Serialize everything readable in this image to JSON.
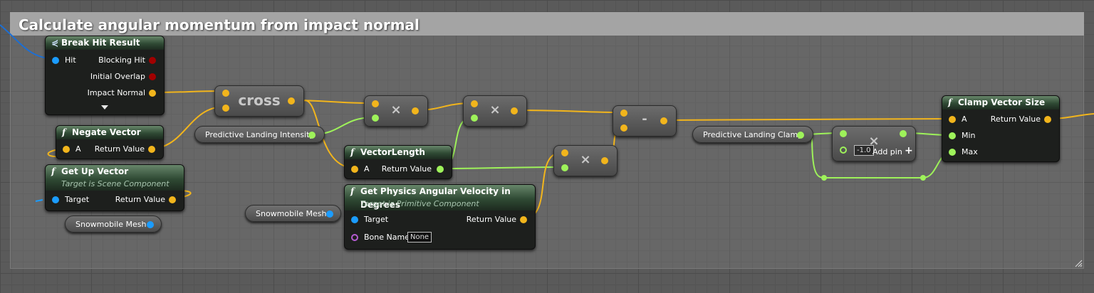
{
  "comment": {
    "title": "Calculate angular momentum from impact normal"
  },
  "nodes": {
    "break_hit": {
      "title": "Break Hit Result",
      "pins": {
        "hit": "Hit",
        "blocking_hit": "Blocking Hit",
        "initial_overlap": "Initial Overlap",
        "impact_normal": "Impact Normal"
      }
    },
    "negate": {
      "title": "Negate Vector",
      "a": "A",
      "ret": "Return Value"
    },
    "get_up": {
      "title": "Get Up Vector",
      "subtitle": "Target is Scene Component",
      "target": "Target",
      "ret": "Return Value"
    },
    "snowmobile_1": {
      "label": "Snowmobile Mesh"
    },
    "cross": {
      "label": "cross"
    },
    "intensity": {
      "label": "Predictive Landing Intensity"
    },
    "mul1": {
      "label": "×"
    },
    "mul2": {
      "label": "×"
    },
    "mul3": {
      "label": "×"
    },
    "vlen": {
      "title": "VectorLength",
      "a": "A",
      "ret": "Return Value"
    },
    "snowmobile_2": {
      "label": "Snowmobile Mesh"
    },
    "angvel": {
      "title": "Get Physics Angular Velocity in Degrees",
      "subtitle": "Target is Primitive Component",
      "target": "Target",
      "bone": "Bone Name",
      "bone_value": "None",
      "ret": "Return Value"
    },
    "minus": {
      "label": "-"
    },
    "clamp_var": {
      "label": "Predictive Landing Clamp"
    },
    "mul4": {
      "label": "×",
      "value": "-1.0",
      "add_pin": "Add pin"
    },
    "clamp": {
      "title": "Clamp Vector Size",
      "a": "A",
      "min": "Min",
      "max": "Max",
      "ret": "Return Value"
    }
  },
  "colors": {
    "vector_pin": "#f2b51c",
    "float_pin": "#9ef25a",
    "object_pin": "#1b9cff",
    "bool_pin": "#a10000",
    "name_pin": "#b55cd2"
  }
}
